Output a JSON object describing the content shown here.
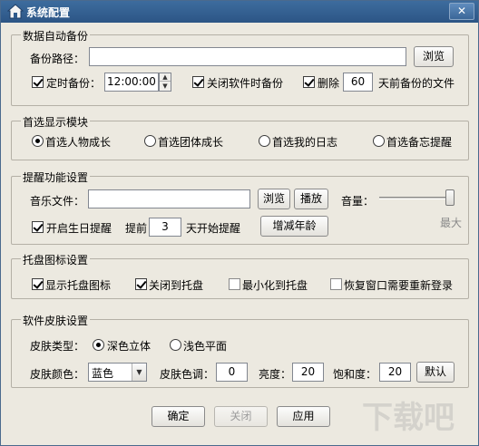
{
  "window": {
    "title": "系统配置",
    "close_glyph": "✕"
  },
  "backup": {
    "group_title": "数据自动备份",
    "path_label": "备份路径：",
    "path_value": "",
    "browse": "浏览",
    "scheduled_label": "定时备份：",
    "scheduled_checked": true,
    "time_value": "12:00:00",
    "on_close_label": "关闭软件时备份",
    "on_close_checked": true,
    "delete_label": "删除",
    "delete_checked": true,
    "days_value": "60",
    "days_suffix": "天前备份的文件"
  },
  "modules": {
    "group_title": "首选显示模块",
    "options": [
      {
        "label": "首选人物成长",
        "selected": true
      },
      {
        "label": "首选团体成长",
        "selected": false
      },
      {
        "label": "首选我的日志",
        "selected": false
      },
      {
        "label": "首选备忘提醒",
        "selected": false
      }
    ]
  },
  "reminder": {
    "group_title": "提醒功能设置",
    "music_label": "音乐文件：",
    "music_value": "",
    "browse": "浏览",
    "play": "播放",
    "volume_label": "音量：",
    "volume_max_label": "最大",
    "volume_level": 1.0,
    "birthday_label": "开启生日提醒",
    "birthday_checked": true,
    "advance_label": "提前",
    "advance_days": "3",
    "advance_suffix": "天开始提醒",
    "age_button": "增减年龄"
  },
  "tray": {
    "group_title": "托盘图标设置",
    "options": [
      {
        "label": "显示托盘图标",
        "checked": true
      },
      {
        "label": "关闭到托盘",
        "checked": true
      },
      {
        "label": "最小化到托盘",
        "checked": false
      },
      {
        "label": "恢复窗口需要重新登录",
        "checked": false
      }
    ]
  },
  "skin": {
    "group_title": "软件皮肤设置",
    "type_label": "皮肤类型：",
    "types": [
      {
        "label": "深色立体",
        "selected": true
      },
      {
        "label": "浅色平面",
        "selected": false
      }
    ],
    "color_label": "皮肤颜色：",
    "color_value": "蓝色",
    "hue_label": "皮肤色调：",
    "hue_value": "0",
    "brightness_label": "亮度：",
    "brightness_value": "20",
    "saturation_label": "饱和度：",
    "saturation_value": "20",
    "default_button": "默认"
  },
  "footer": {
    "ok": "确定",
    "close": "关闭",
    "apply": "应用"
  },
  "watermark": "下载吧",
  "colors": {
    "titlebar": "#2f5b8c",
    "dialog_bg": "#ece9e0"
  }
}
